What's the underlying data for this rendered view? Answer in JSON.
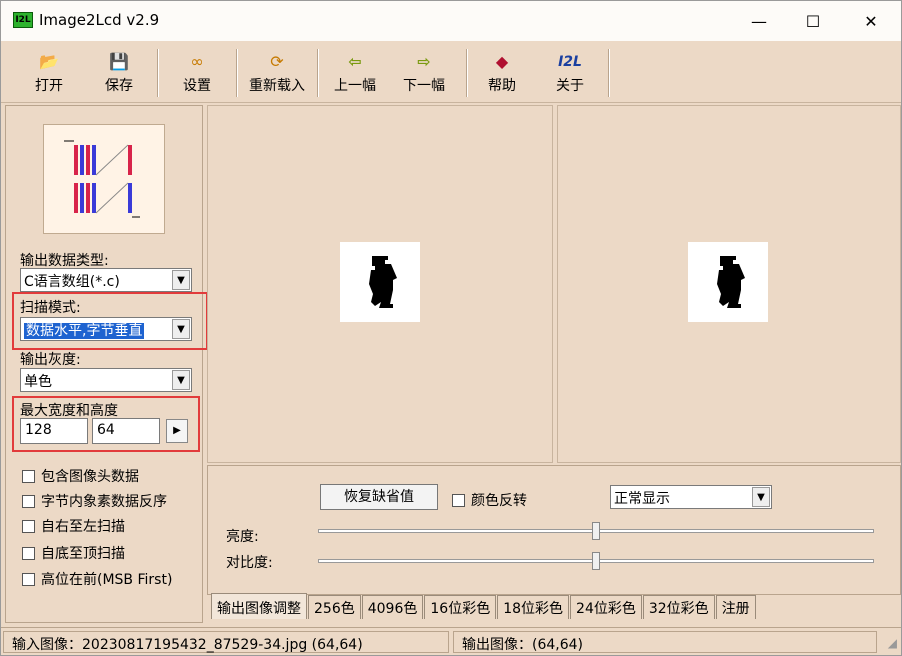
{
  "window": {
    "icon_text": "I2L",
    "title": "Image2Lcd v2.9",
    "minimize": "—",
    "maximize": "☐",
    "close": "✕"
  },
  "toolbar": {
    "open": "打开",
    "save": "保存",
    "settings": "设置",
    "reload": "重新载入",
    "prev": "上一幅",
    "next": "下一幅",
    "help": "帮助",
    "about": "关于",
    "about_icon_text": "I2L"
  },
  "left": {
    "output_type_label": "输出数据类型:",
    "output_type_value": "C语言数组(*.c)",
    "scan_mode_label": "扫描模式:",
    "scan_mode_value": "数据水平,字节垂直",
    "gray_label": "输出灰度:",
    "gray_value": "单色",
    "max_size_label": "最大宽度和高度",
    "max_width": "128",
    "max_height": "64",
    "checkboxes": [
      "包含图像头数据",
      "字节内象素数据反序",
      "自右至左扫描",
      "自底至顶扫描",
      "高位在前(MSB First)"
    ]
  },
  "controls": {
    "restore_default": "恢复缺省值",
    "invert_label": "颜色反转",
    "display_mode": "正常显示",
    "brightness_label": "亮度:",
    "contrast_label": "对比度:",
    "brightness_level": 0.5,
    "contrast_level": 0.5
  },
  "tabs": [
    "输出图像调整",
    "256色",
    "4096色",
    "16位彩色",
    "18位彩色",
    "24位彩色",
    "32位彩色",
    "注册"
  ],
  "status": {
    "input": "输入图像：20230817195432_87529-34.jpg (64,64)",
    "output": "输出图像：(64,64)"
  },
  "colors": {
    "panel": "#ecd9c6",
    "highlight_red": "#e23b3b",
    "selection_blue": "#1e63d0"
  }
}
